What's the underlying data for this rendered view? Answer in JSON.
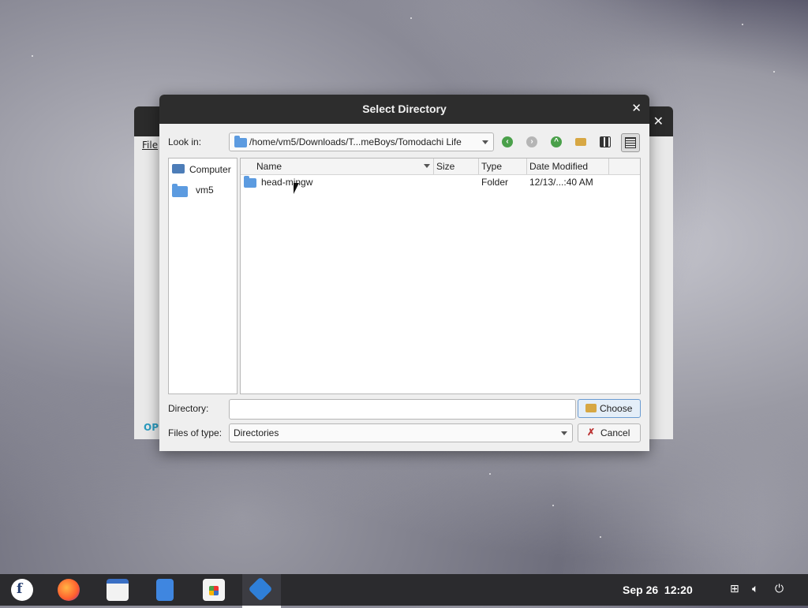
{
  "dialog": {
    "title": "Select Directory",
    "close_glyph": "✕",
    "look_in_label": "Look in:",
    "look_in_path": "/home/vm5/Downloads/T...meBoys/Tomodachi Life",
    "sidebar": [
      {
        "label": "Computer",
        "icon": "computer-icon"
      },
      {
        "label": "vm5",
        "icon": "folder-icon"
      }
    ],
    "columns": [
      "Name",
      "Size",
      "Type",
      "Date Modified"
    ],
    "rows": [
      {
        "name": "head-mingw",
        "size": "",
        "type": "Folder",
        "date": "12/13/...:40 AM"
      }
    ],
    "directory_label": "Directory:",
    "directory_value": "",
    "choose_label": "Choose",
    "files_type_label": "Files of type:",
    "files_type_value": "Directories",
    "cancel_label": "Cancel"
  },
  "background_window": {
    "menu_label": "File",
    "op_label": "OP",
    "close_glyph": "✕"
  },
  "taskbar": {
    "date": "Sep 26",
    "time": "12:20",
    "apps": [
      "fedora-icon",
      "firefox-icon",
      "calendar-icon",
      "file-manager-icon",
      "software-icon",
      "app-icon"
    ]
  },
  "colors": {
    "accent": "#5c9be0",
    "titlebar": "#2d2d2d",
    "taskbar": "#2b2b2e"
  }
}
